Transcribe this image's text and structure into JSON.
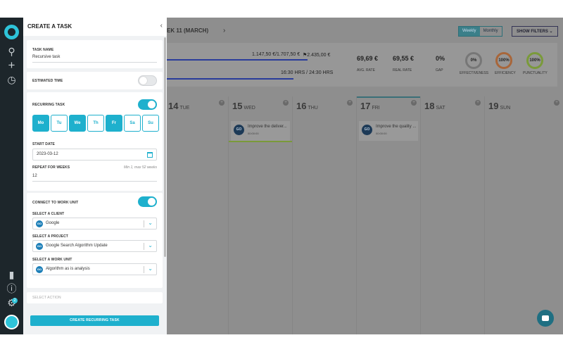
{
  "panel": {
    "title": "CREATE A TASK",
    "task_name_label": "TASK NAME",
    "task_name_value": "Recursive task",
    "estimated_time_label": "ESTIMATED TIME",
    "estimated_time_on": false,
    "recurring_label": "RECURRING TASK",
    "recurring_on": true,
    "days": [
      {
        "label": "Mo",
        "selected": true
      },
      {
        "label": "Tu",
        "selected": false
      },
      {
        "label": "We",
        "selected": true
      },
      {
        "label": "Th",
        "selected": false
      },
      {
        "label": "Fr",
        "selected": true
      },
      {
        "label": "Sa",
        "selected": false
      },
      {
        "label": "Su",
        "selected": false
      }
    ],
    "start_date_label": "START DATE",
    "start_date_value": "2023-03-12",
    "repeat_label": "REPEAT FOR WEEKS",
    "repeat_hint": "Min 1, max 52 weeks",
    "repeat_value": "12",
    "connect_label": "CONNECT TO WORK UNIT",
    "connect_on": true,
    "client_label": "SELECT A CLIENT",
    "client_value": "Google",
    "project_label": "SELECT A PROJECT",
    "project_value": "Google Search Algorithm Update",
    "work_unit_label": "SELECT A WORK UNIT",
    "work_unit_value": "Algorithm as is analysis",
    "go_badge": "GO",
    "action_label": "SELECT ACTION",
    "create_button": "CREATE RECURRING TASK"
  },
  "background": {
    "week_label": "EK 11 (MARCH)",
    "view_weekly": "Weekly",
    "view_monthly": "Monthly",
    "show_filters": "SHOW FILTERS",
    "amount_line": "1.147,50 €/1.707,50 €",
    "amount_flag": "2.435,00 €",
    "hours_line": "16:30 HRS / 24:30 HRS",
    "avg_rate_value": "69,69 €",
    "avg_rate_label": "AVG. RATE",
    "real_rate_value": "69,55 €",
    "real_rate_label": "REAL RATE",
    "gap_value": "0%",
    "gap_label": "GAP",
    "effectiveness_value": "0%",
    "effectiveness_label": "EFFECTIVENESS",
    "efficiency_value": "100%",
    "efficiency_label": "EFFICIENCY",
    "punctuality_value": "100%",
    "punctuality_label": "PUNCTUALITY",
    "days": [
      {
        "num": "14",
        "name": "TUE"
      },
      {
        "num": "15",
        "name": "WED"
      },
      {
        "num": "16",
        "name": "THU"
      },
      {
        "num": "17",
        "name": "FRI"
      },
      {
        "num": "18",
        "name": "SAT"
      },
      {
        "num": "19",
        "name": "SUN"
      }
    ],
    "card_wed_title": "Improve the deliver...",
    "card_wed_time": "00:00:00",
    "card_fri_title": "Improve the quality ...",
    "card_fri_time": "00:00:00"
  },
  "colors": {
    "accent": "#1eb0cd",
    "nav": "#1d262b"
  }
}
